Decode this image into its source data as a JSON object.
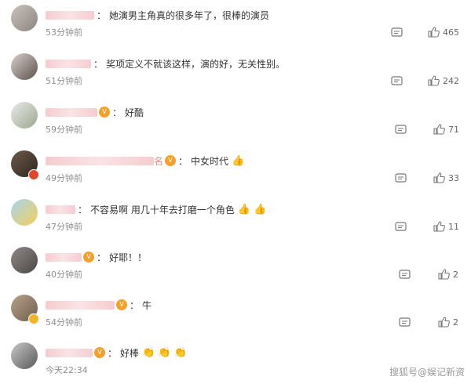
{
  "comments": [
    {
      "time": "53分钟前",
      "text": "她演男主角真的很多年了，很棒的演员",
      "likes": "465",
      "colon": "：",
      "vip": "",
      "emoji": "",
      "badge": ""
    },
    {
      "time": "51分钟前",
      "text": "奖项定义不就该这样，演的好，无关性别。",
      "likes": "242",
      "colon": "：",
      "vip": "",
      "emoji": "",
      "badge": ""
    },
    {
      "time": "59分钟前",
      "text": "好酷",
      "likes": "71",
      "colon": "：",
      "vip": "V",
      "emoji": "",
      "badge": ""
    },
    {
      "time": "49分钟前",
      "text": "中女时代",
      "likes": "33",
      "colon": "：",
      "vip": "V",
      "name_suffix": "名",
      "emoji": "👍",
      "badge": "red"
    },
    {
      "time": "47分钟前",
      "text": "不容易啊 用几十年去打磨一个角色",
      "likes": "11",
      "colon": "：",
      "vip": "",
      "emoji": "👍 👍",
      "badge": ""
    },
    {
      "time": "40分钟前",
      "text": "好耶！！",
      "likes": "2",
      "colon": "：",
      "vip": "V",
      "emoji": "",
      "badge": ""
    },
    {
      "time": "54分钟前",
      "text": "牛",
      "likes": "2",
      "colon": "：",
      "vip": "V",
      "emoji": "",
      "badge": "gold"
    },
    {
      "time": "今天22:34",
      "text": "好棒",
      "likes": "",
      "colon": "：",
      "vip": "V",
      "emoji": "👏 👏 👏",
      "badge": ""
    }
  ],
  "watermark": "搜狐号@娱记新资",
  "icons": {
    "reply": "comment-icon",
    "like": "thumbs-up-icon"
  }
}
